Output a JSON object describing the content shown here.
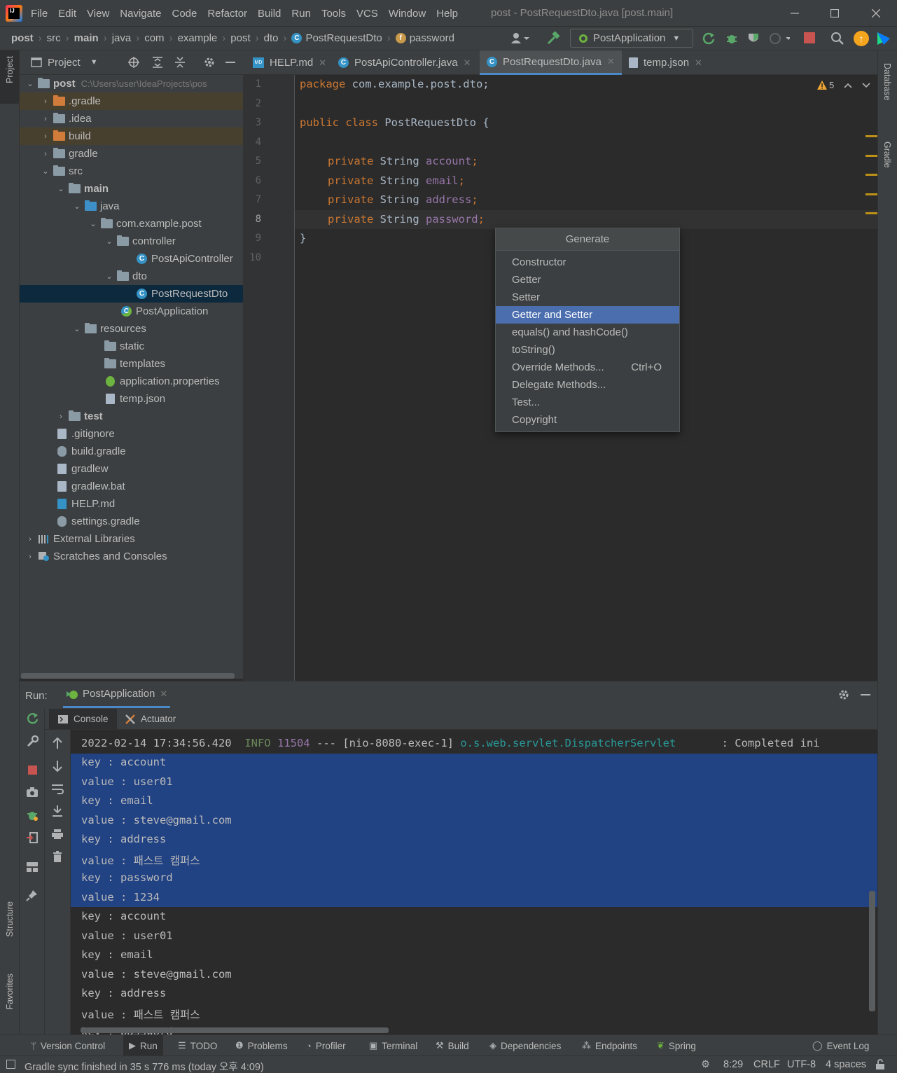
{
  "menu_bar": {
    "items": [
      "File",
      "Edit",
      "View",
      "Navigate",
      "Code",
      "Refactor",
      "Build",
      "Run",
      "Tools",
      "VCS",
      "Window",
      "Help"
    ],
    "window_title": "post - PostRequestDto.java [post.main]"
  },
  "breadcrumb": [
    "post",
    "src",
    "main",
    "java",
    "com",
    "example",
    "post",
    "dto",
    "PostRequestDto",
    "password"
  ],
  "toolbar": {
    "run_config": "PostApplication"
  },
  "left_stripe": {
    "project": "Project",
    "structure": "Structure",
    "favorites": "Favorites"
  },
  "right_stripe": {
    "database": "Database",
    "gradle": "Gradle"
  },
  "project_panel": {
    "title": "Project",
    "root_label": "post",
    "root_path": "C:\\Users\\user\\IdeaProjects\\pos",
    "tree": [
      "post",
      ".gradle",
      ".idea",
      "build",
      "gradle",
      "src",
      "main",
      "java",
      "com.example.post",
      "controller",
      "PostApiController",
      "dto",
      "PostRequestDto",
      "PostApplication",
      "resources",
      "static",
      "templates",
      "application.properties",
      "temp.json",
      "test",
      ".gitignore",
      "build.gradle",
      "gradlew",
      "gradlew.bat",
      "HELP.md",
      "settings.gradle",
      "External Libraries",
      "Scratches and Consoles"
    ]
  },
  "editor": {
    "tabs": [
      "HELP.md",
      "PostApiController.java",
      "PostRequestDto.java",
      "temp.json"
    ],
    "active_tab": "PostRequestDto.java",
    "inspection_warnings": "5",
    "line_numbers": [
      "1",
      "2",
      "3",
      "4",
      "5",
      "6",
      "7",
      "8",
      "9",
      "10"
    ],
    "code": {
      "l1_kw": "package",
      "l1_rest": " com.example.post.dto;",
      "l3_kw": "public class",
      "l3_rest": " PostRequestDto {",
      "kw_private": "private",
      "type": " String ",
      "f1": "account",
      "f2": "email",
      "f3": "address",
      "f4": "password",
      "semi": ";",
      "l10": "}"
    }
  },
  "generate_popup": {
    "title": "Generate",
    "items": [
      "Constructor",
      "Getter",
      "Setter",
      "Getter and Setter",
      "equals() and hashCode()",
      "toString()",
      "Override Methods...",
      "Delegate Methods...",
      "Test...",
      "Copyright"
    ],
    "selected": "Getter and Setter",
    "override_shortcut": "Ctrl+O"
  },
  "run_panel": {
    "label": "Run:",
    "config_tab": "PostApplication",
    "subtabs": [
      "Console",
      "Actuator"
    ],
    "log": {
      "timestamp": "2022-02-14 17:34:56.420",
      "level": "INFO",
      "pid": "11504",
      "dashes": "---",
      "thread": "[nio-8080-exec-1]",
      "logger": "o.s.web.servlet.DispatcherServlet",
      "message": ": Completed ini"
    },
    "output_lines": [
      "key : account",
      "value : user01",
      "key : email",
      "value : steve@gmail.com",
      "key : address",
      "value : 패스트 캠퍼스",
      "key : password",
      "value : 1234",
      "key : account",
      "value : user01",
      "key : email",
      "value : steve@gmail.com",
      "key : address",
      "value : 패스트 캠퍼스",
      "key : password"
    ]
  },
  "tool_windows": [
    "Version Control",
    "Run",
    "TODO",
    "Problems",
    "Profiler",
    "Terminal",
    "Build",
    "Dependencies",
    "Endpoints",
    "Spring"
  ],
  "event_log": "Event Log",
  "status_bar": {
    "message": "Gradle sync finished in 35 s 776 ms (today 오후 4:09)",
    "position": "8:29",
    "line_sep": "CRLF",
    "encoding": "UTF-8",
    "indent": "4 spaces"
  },
  "colors": {
    "background": "#2b2b2b",
    "panel": "#3c3f41",
    "keyword": "#cc7832",
    "field": "#9876aa",
    "selection": "#214283",
    "popup_selected": "#4b6eaf",
    "info_green": "#6a8759",
    "logger_cyan": "#299999"
  }
}
